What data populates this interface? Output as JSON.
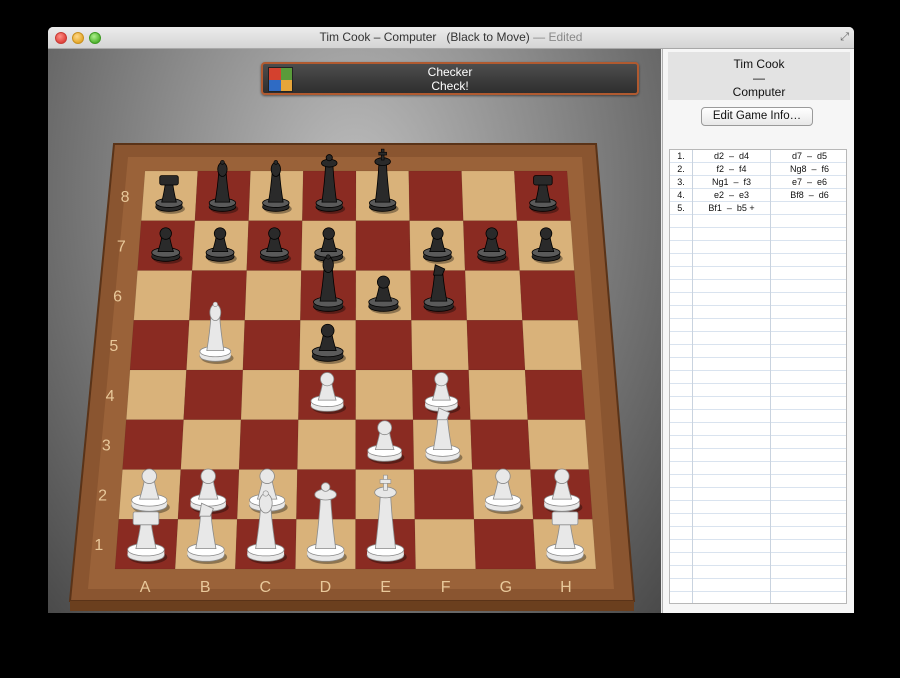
{
  "window": {
    "title": "Tim Cook – Computer   (Black to Move)",
    "title_suffix": " — Edited",
    "fullscreen_icon": "fullscreen-arrows-icon"
  },
  "status": {
    "line1": "Checker",
    "line2": "Check!",
    "icon": "game-center-icon"
  },
  "board": {
    "files": [
      "A",
      "B",
      "C",
      "D",
      "E",
      "F",
      "G",
      "H"
    ],
    "ranks": [
      "1",
      "2",
      "3",
      "4",
      "5",
      "6",
      "7",
      "8"
    ],
    "colors": {
      "light": "#d9b27a",
      "dark": "#8a2b22",
      "frame": "#8a5530",
      "frame_light": "#b77c4b",
      "label": "#e8c89a"
    },
    "pieces": [
      {
        "sq": "a8",
        "color": "black",
        "type": "rook"
      },
      {
        "sq": "b8",
        "color": "black",
        "type": "bishop"
      },
      {
        "sq": "c8",
        "color": "black",
        "type": "bishop"
      },
      {
        "sq": "d8",
        "color": "black",
        "type": "queen"
      },
      {
        "sq": "e8",
        "color": "black",
        "type": "king"
      },
      {
        "sq": "h8",
        "color": "black",
        "type": "rook"
      },
      {
        "sq": "a7",
        "color": "black",
        "type": "pawn"
      },
      {
        "sq": "b7",
        "color": "black",
        "type": "pawn"
      },
      {
        "sq": "c7",
        "color": "black",
        "type": "pawn"
      },
      {
        "sq": "f7",
        "color": "black",
        "type": "pawn"
      },
      {
        "sq": "g7",
        "color": "black",
        "type": "pawn"
      },
      {
        "sq": "h7",
        "color": "black",
        "type": "pawn"
      },
      {
        "sq": "d7",
        "color": "black",
        "type": "pawn"
      },
      {
        "sq": "e6",
        "color": "black",
        "type": "pawn"
      },
      {
        "sq": "f6",
        "color": "black",
        "type": "knight"
      },
      {
        "sq": "d6",
        "color": "black",
        "type": "bishop"
      },
      {
        "sq": "d5",
        "color": "black",
        "type": "pawn"
      },
      {
        "sq": "b5",
        "color": "white",
        "type": "bishop"
      },
      {
        "sq": "d4",
        "color": "white",
        "type": "pawn"
      },
      {
        "sq": "f4",
        "color": "white",
        "type": "pawn"
      },
      {
        "sq": "e3",
        "color": "white",
        "type": "pawn"
      },
      {
        "sq": "f3",
        "color": "white",
        "type": "knight"
      },
      {
        "sq": "a2",
        "color": "white",
        "type": "pawn"
      },
      {
        "sq": "b2",
        "color": "white",
        "type": "pawn"
      },
      {
        "sq": "c2",
        "color": "white",
        "type": "pawn"
      },
      {
        "sq": "g2",
        "color": "white",
        "type": "pawn"
      },
      {
        "sq": "h2",
        "color": "white",
        "type": "pawn"
      },
      {
        "sq": "a1",
        "color": "white",
        "type": "rook"
      },
      {
        "sq": "b1",
        "color": "white",
        "type": "knight"
      },
      {
        "sq": "c1",
        "color": "white",
        "type": "bishop"
      },
      {
        "sq": "d1",
        "color": "white",
        "type": "queen"
      },
      {
        "sq": "e1",
        "color": "white",
        "type": "king"
      },
      {
        "sq": "h1",
        "color": "white",
        "type": "rook"
      }
    ]
  },
  "panel": {
    "player1": "Tim Cook",
    "separator": "—",
    "player2": "Computer",
    "edit_button": "Edit Game Info…",
    "moves": [
      {
        "num": "1.",
        "white": "d2  –  d4",
        "black": "d7  –  d5"
      },
      {
        "num": "2.",
        "white": "f2  –  f4",
        "black": "Ng8  –  f6"
      },
      {
        "num": "3.",
        "white": "Ng1  –  f3",
        "black": "e7  –  e6"
      },
      {
        "num": "4.",
        "white": "e2  –  e3",
        "black": "Bf8  –  d6"
      },
      {
        "num": "5.",
        "white": "Bf1  –  b5 +",
        "black": ""
      }
    ]
  }
}
